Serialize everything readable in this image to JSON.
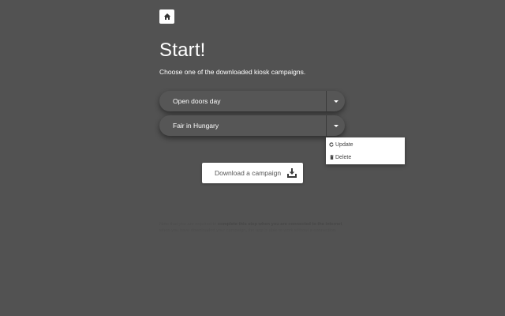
{
  "header": {
    "home_icon": "home-icon",
    "title": "Start!",
    "subtitle": "Choose one of the downloaded kiosk campaigns."
  },
  "campaigns": [
    {
      "name": "Open doors day",
      "toggle_icon": "caret-down-icon"
    },
    {
      "name": "Fair in Hungary",
      "toggle_icon": "caret-down-icon"
    }
  ],
  "campaign_menu": {
    "open_for": "Fair in Hungary",
    "items": [
      {
        "label": "Update",
        "icon": "refresh-icon"
      },
      {
        "label": "Delete",
        "icon": "trash-icon"
      }
    ]
  },
  "download": {
    "label": "Download a campaign",
    "icon": "download-tray-icon"
  },
  "note": {
    "part1": "Note that you are required to ",
    "bold1": "complete this step when you are connected to the internet",
    "part2": ", when you have downloaded your campaign, the app is able to work without a connection."
  },
  "colors": {
    "background": "#525252",
    "pill": "#565656",
    "text_primary": "#ffffff",
    "card": "#ffffff"
  }
}
